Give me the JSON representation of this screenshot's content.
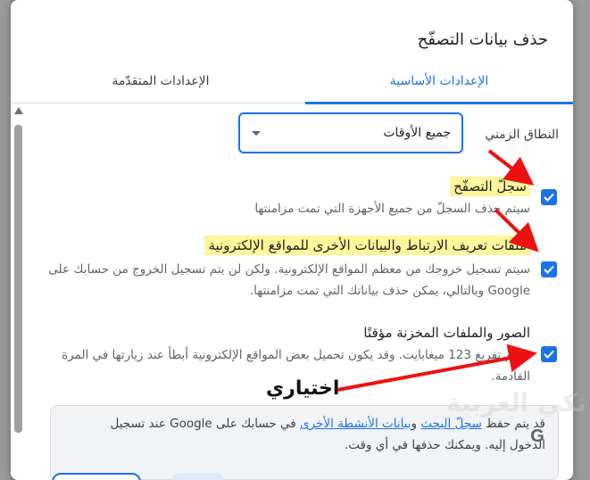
{
  "dialog": {
    "title": "حذف بيانات التصفّح"
  },
  "tabs": [
    {
      "label": "الإعدادات الأساسية",
      "active": true
    },
    {
      "label": "الإعدادات المتقدّمة",
      "active": false
    }
  ],
  "time_range": {
    "label": "النطاق الزمني",
    "value": "جميع الأوقات"
  },
  "items": [
    {
      "title": "سجلّ التصفّح",
      "description": "سيتم حذف السجلّ من جميع الأجهزة التي تمت مزامنتها",
      "checked": true
    },
    {
      "title": "ملفات تعريف الارتباط والبيانات الأخرى للمواقع الإلكترونية",
      "description": "سيتم تسجيل خروجك من معظم المواقع الإلكترونية. ولكن لن يتم تسجيل الخروج من حسابك على Google وبالتالي، يمكن حذف بياناتك التي تمت مزامنتها.",
      "checked": true
    },
    {
      "title": "الصور والملفات المخزنة مؤقتًا",
      "description": "سيتم تفريغ 123 ميغابايت. وقد يكون تحميل بعض المواقع الإلكترونية أبطأ عند زيارتها في المرة القادمة.",
      "checked": true
    }
  ],
  "info": {
    "prefix": "قد يتم حفظ ",
    "link1": "سجلّ البحث",
    "middle": " و",
    "link2": "بيانات الأنشطة الأخرى",
    "suffix": " في حسابك على Google عند تسجيل الدخول إليه. ويمكنك حذفها في أي وقت.",
    "icon": "G"
  },
  "annotation": {
    "label": "اختياري"
  },
  "watermark": "تكي العربية",
  "colors": {
    "accent": "#1a73e8",
    "highlight": "#fff59a",
    "arrow": "#ee1111"
  }
}
